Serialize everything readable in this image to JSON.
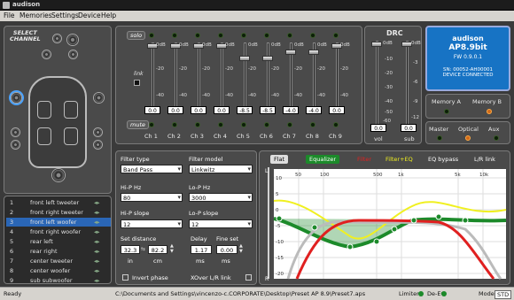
{
  "window": {
    "title": "audison"
  },
  "menu": [
    "File",
    "Memories",
    "Settings",
    "Device",
    "Help"
  ],
  "select_channel": {
    "title_line1": "SELECT",
    "title_line2": "CHANNEL"
  },
  "channel_list": [
    {
      "num": "1",
      "name": "front left tweeter",
      "selected": false
    },
    {
      "num": "2",
      "name": "front right tweeter",
      "selected": false
    },
    {
      "num": "3",
      "name": "front left woofer",
      "selected": true
    },
    {
      "num": "4",
      "name": "front right woofer",
      "selected": false
    },
    {
      "num": "5",
      "name": "rear left",
      "selected": false
    },
    {
      "num": "6",
      "name": "rear right",
      "selected": false
    },
    {
      "num": "7",
      "name": "center tweeter",
      "selected": false
    },
    {
      "num": "8",
      "name": "center woofer",
      "selected": false
    },
    {
      "num": "9",
      "name": "sub subwoofer",
      "selected": false
    }
  ],
  "mixer": {
    "solo": "solo",
    "link": "link",
    "mute": "mute",
    "db_top": "0dB",
    "db_mid": "-20",
    "db_low": "-40",
    "channels": [
      {
        "name": "Ch 1",
        "value": "0.0",
        "level": 1.0
      },
      {
        "name": "Ch 2",
        "value": "0.0",
        "level": 1.0
      },
      {
        "name": "Ch 3",
        "value": "0.0",
        "level": 1.0
      },
      {
        "name": "Ch 4",
        "value": "0.0",
        "level": 1.0
      },
      {
        "name": "Ch 5",
        "value": "-8.5",
        "level": 0.8
      },
      {
        "name": "Ch 6",
        "value": "-8.5",
        "level": 0.8
      },
      {
        "name": "Ch 7",
        "value": "-4.0",
        "level": 0.9
      },
      {
        "name": "Ch 8",
        "value": "-4.0",
        "level": 0.9
      },
      {
        "name": "Ch 9",
        "value": "0.0",
        "level": 1.0
      }
    ]
  },
  "drc": {
    "title": "DRC",
    "vol_scale": [
      "0dB",
      "-10",
      "-20",
      "-30",
      "-40",
      "-50",
      "-60"
    ],
    "sub_scale": [
      "0dB",
      "-3",
      "-6",
      "-9",
      "-12"
    ],
    "vol_value": "0.0",
    "sub_value": "0.0",
    "vol_label": "vol",
    "sub_label": "sub"
  },
  "device": {
    "brand": "audison",
    "model": "AP8.9bit",
    "fw": "FW 0.9.0.1",
    "sn": "SN: 00052-AH00001",
    "status": "DEVICE CONNECTED"
  },
  "memory": {
    "a": "Memory A",
    "b": "Memory B",
    "active": "b"
  },
  "source": {
    "master": "Master",
    "optical": "Optical",
    "aux": "Aux",
    "active": "optical"
  },
  "filter": {
    "type_label": "Filter type",
    "type_value": "Band Pass",
    "model_label": "Filter model",
    "model_value": "Linkwitz",
    "hp_hz_label": "Hi-P Hz",
    "hp_hz_value": "80",
    "lp_hz_label": "Lo-P Hz",
    "lp_hz_value": "3000",
    "hp_slope_label": "Hi-P slope",
    "hp_slope_value": "12",
    "lp_slope_label": "Lo-P slope",
    "lp_slope_value": "12",
    "set_distance_label": "Set distance",
    "dist_in": "32.3",
    "dist_cm": "82.2",
    "in_label": "in",
    "cm_label": "cm",
    "delay_label": "Delay",
    "delay_value": "1.17",
    "delay_unit": "ms",
    "fine_label": "Fine set",
    "fine_value": "0.00",
    "fine_unit": "ms",
    "invert": "Invert phase",
    "xover_link": "XOver L/R link"
  },
  "graph": {
    "flat": "Flat",
    "equalizer": "Equalizer",
    "filter": "Filter",
    "filter_eq": "Filter+EQ",
    "eq_bypass": "EQ bypass",
    "lr_link": "L/R link",
    "freq_labels": [
      "50",
      "100",
      "500",
      "1k",
      "5k",
      "10k"
    ],
    "db_labels": [
      "10",
      "5",
      "0",
      "-5",
      "-10",
      "-15",
      "-20"
    ],
    "left_marker": "L",
    "right_marker": "R",
    "colors": {
      "filter": "#e02020",
      "eq": "#f0f020",
      "curve": "#1c8a2a",
      "bg": "#ffffff"
    }
  },
  "status": {
    "ready": "Ready",
    "path": "C:\\Documents and Settings\\vincenzo-c.CORPORATE\\Desktop\\Preset AP 8.9\\Preset7.aps",
    "limiter": "Limiter",
    "de_eq": "De-EQ",
    "mode": "Mode",
    "std": "STD"
  }
}
